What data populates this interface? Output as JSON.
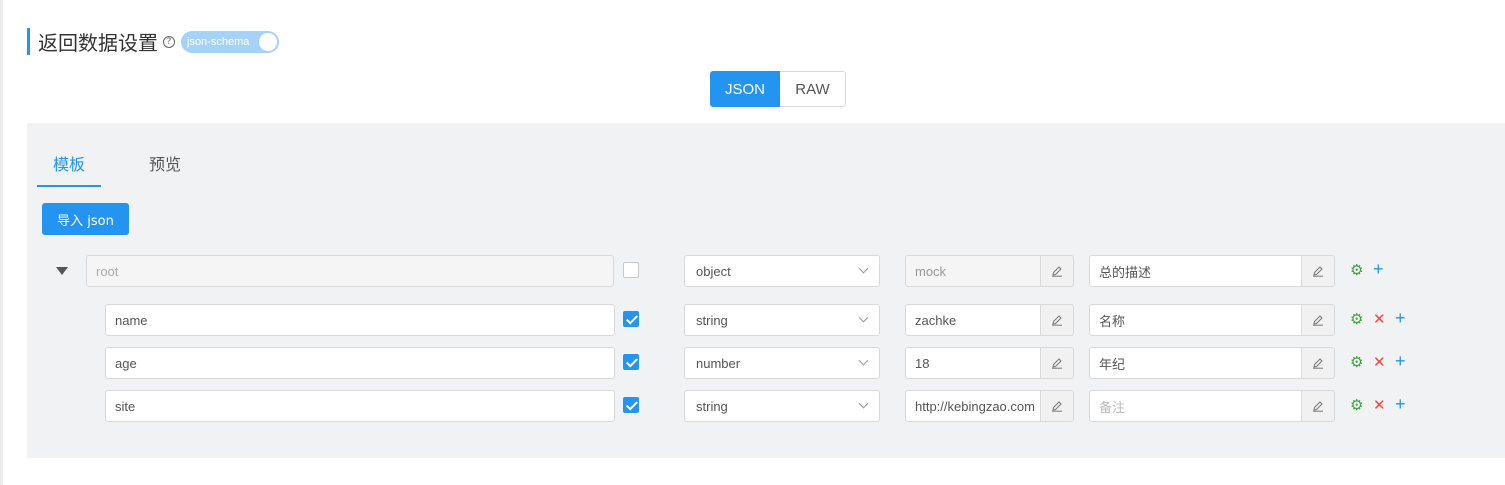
{
  "header": {
    "title": "返回数据设置",
    "help_glyph": "?",
    "toggle_label": "json-schema"
  },
  "format_tabs": {
    "json": "JSON",
    "raw": "RAW"
  },
  "panel_tabs": {
    "template": "模板",
    "preview": "预览"
  },
  "import_button": "导入 json",
  "root": {
    "name_placeholder": "root",
    "type": "object",
    "mock_placeholder": "mock",
    "description": "总的描述"
  },
  "fields": [
    {
      "name": "name",
      "required": true,
      "type": "string",
      "mock": "zachke",
      "description": "名称"
    },
    {
      "name": "age",
      "required": true,
      "type": "number",
      "mock": "18",
      "description": "年纪"
    },
    {
      "name": "site",
      "required": true,
      "type": "string",
      "mock": "http://kebingzao.com",
      "description": "",
      "description_placeholder": "备注"
    }
  ],
  "icons": {
    "expand": "caret-down-icon",
    "edit": "edit-icon",
    "settings": "gear-icon",
    "delete": "close-icon",
    "add": "plus-icon"
  },
  "colors": {
    "primary": "#2395f1",
    "settings": "#3aa63a",
    "delete": "#f0483e",
    "panel_bg": "#f1f2f4"
  }
}
